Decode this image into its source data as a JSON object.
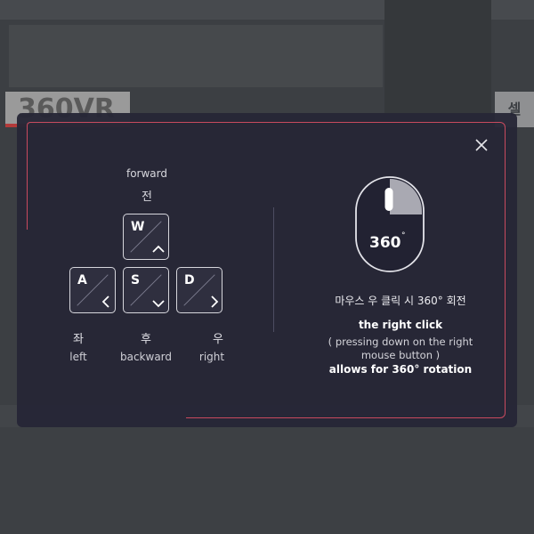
{
  "background": {
    "sign_left": "360VR",
    "sign_right": "셀"
  },
  "controls": {
    "forward": {
      "en": "forward",
      "ko": "전",
      "key": "W"
    },
    "left": {
      "en": "left",
      "ko": "좌",
      "key": "A"
    },
    "backward": {
      "en": "backward",
      "ko": "후",
      "key": "S"
    },
    "right": {
      "en": "right",
      "ko": "우",
      "key": "D"
    }
  },
  "mouse": {
    "badge": "360",
    "ko_text": "마우스 우 클릭 시 360° 회전",
    "line1": "the right click",
    "line2": "( pressing down on the right",
    "line3": "mouse button )",
    "line4": "allows for 360° rotation"
  },
  "colors": {
    "accent": "#c84a5e",
    "panel": "#262636",
    "text": "#ececf0"
  },
  "icons": {
    "close": "close-icon",
    "mouse": "mouse-icon",
    "arrows": [
      "chevron-up-icon",
      "chevron-left-icon",
      "chevron-down-icon",
      "chevron-right-icon"
    ]
  }
}
